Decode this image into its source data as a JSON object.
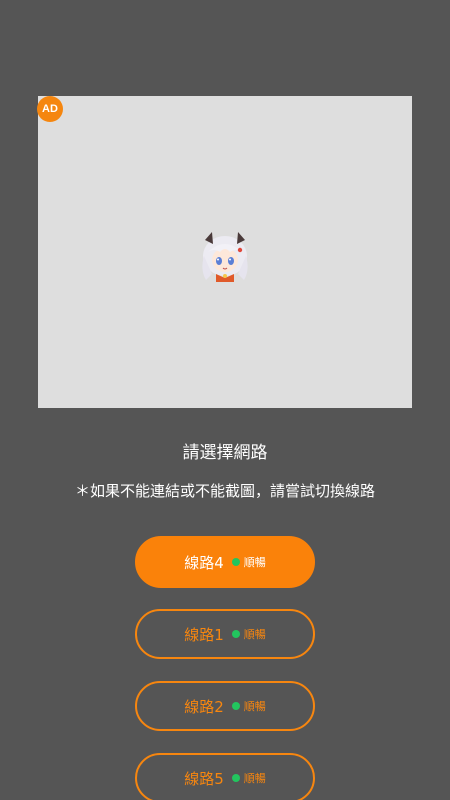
{
  "ad": {
    "badge": "AD"
  },
  "header": {
    "title": "請選擇網路",
    "notice": "＊如果不能連結或不能截圖，請嘗試切換線路"
  },
  "routes": [
    {
      "label": "線路4",
      "status": "順暢",
      "active": true
    },
    {
      "label": "線路1",
      "status": "順暢",
      "active": false
    },
    {
      "label": "線路2",
      "status": "順暢",
      "active": false
    },
    {
      "label": "線路5",
      "status": "順暢",
      "active": false
    }
  ],
  "colors": {
    "background": "#555555",
    "accent": "#f7860f",
    "status_dot": "#22c55e",
    "ad_area": "#dedede"
  }
}
